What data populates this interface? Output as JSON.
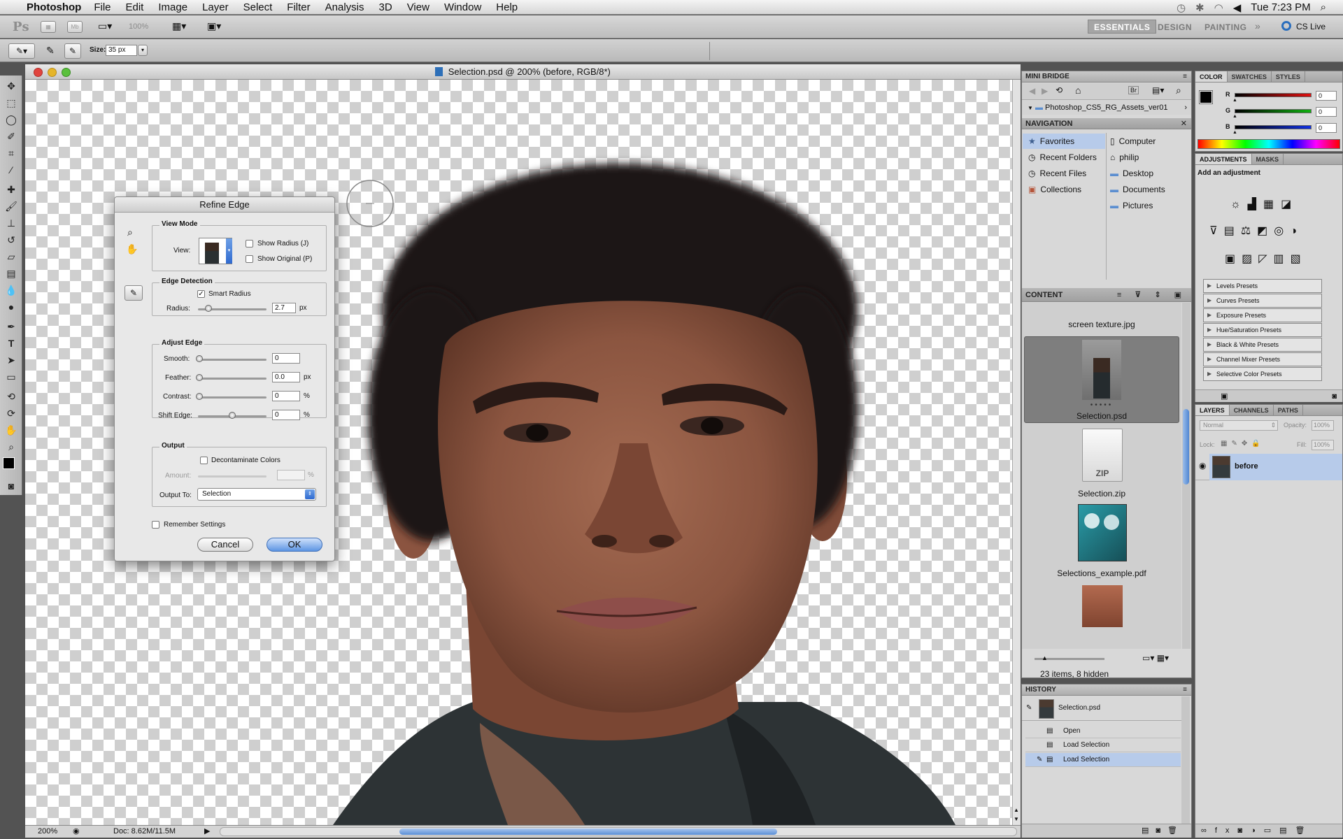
{
  "menubar": {
    "app_name": "Photoshop",
    "items": [
      "File",
      "Edit",
      "Image",
      "Layer",
      "Select",
      "Filter",
      "Analysis",
      "3D",
      "View",
      "Window",
      "Help"
    ],
    "clock": "Tue 7:23 PM"
  },
  "appbar": {
    "zoom": "100%",
    "workspaces": [
      "ESSENTIALS",
      "DESIGN",
      "PAINTING"
    ],
    "cs_live": "CS Live"
  },
  "options": {
    "size_label": "Size:",
    "size_value": "35 px"
  },
  "document": {
    "title": "Selection.psd @ 200% (before, RGB/8*)",
    "zoom": "200%",
    "doc_info": "Doc: 8.62M/11.5M"
  },
  "dialog": {
    "title": "Refine Edge",
    "view_mode": {
      "label": "View Mode",
      "view": "View:",
      "show_radius": "Show Radius (J)",
      "show_original": "Show Original (P)"
    },
    "edge_detection": {
      "label": "Edge Detection",
      "smart_radius": "Smart Radius",
      "radius_label": "Radius:",
      "radius_value": "2.7",
      "radius_unit": "px",
      "radius_frac": 0.15
    },
    "adjust_edge": {
      "label": "Adjust Edge",
      "smooth_label": "Smooth:",
      "smooth_value": "0",
      "feather_label": "Feather:",
      "feather_value": "0.0",
      "feather_unit": "px",
      "contrast_label": "Contrast:",
      "contrast_value": "0",
      "contrast_unit": "%",
      "shift_label": "Shift Edge:",
      "shift_value": "0",
      "shift_unit": "%",
      "shift_frac": 0.5
    },
    "output": {
      "label": "Output",
      "decontaminate": "Decontaminate Colors",
      "amount_label": "Amount:",
      "amount_unit": "%",
      "output_to_label": "Output To:",
      "output_to_value": "Selection"
    },
    "remember": "Remember Settings",
    "cancel": "Cancel",
    "ok": "OK"
  },
  "mini_bridge": {
    "title": "MINI BRIDGE",
    "path": "Photoshop_CS5_RG_Assets_ver01",
    "nav_header": "NAVIGATION",
    "left_items": [
      "Favorites",
      "Recent Folders",
      "Recent Files",
      "Collections"
    ],
    "right_items": [
      "Computer",
      "philip",
      "Desktop",
      "Documents",
      "Pictures"
    ],
    "content_header": "CONTENT",
    "files": [
      "screen texture.jpg",
      "Selection.psd",
      "Selection.zip",
      "Selections_example.pdf"
    ],
    "zip_label": "ZIP",
    "status": "23 items, 8 hidden"
  },
  "history": {
    "title": "HISTORY",
    "snapshot": "Selection.psd",
    "steps": [
      "Open",
      "Load Selection",
      "Load Selection"
    ]
  },
  "color_panel": {
    "tabs": [
      "COLOR",
      "SWATCHES",
      "STYLES"
    ],
    "channels": [
      {
        "name": "R",
        "value": "0",
        "color": "#e01010"
      },
      {
        "name": "G",
        "value": "0",
        "color": "#10b010"
      },
      {
        "name": "B",
        "value": "0",
        "color": "#1030e0"
      }
    ]
  },
  "adjustments": {
    "tabs": [
      "ADJUSTMENTS",
      "MASKS"
    ],
    "hint": "Add an adjustment",
    "presets": [
      "Levels Presets",
      "Curves Presets",
      "Exposure Presets",
      "Hue/Saturation Presets",
      "Black & White Presets",
      "Channel Mixer Presets",
      "Selective Color Presets"
    ]
  },
  "layers": {
    "tabs": [
      "LAYERS",
      "CHANNELS",
      "PATHS"
    ],
    "blend": "Normal",
    "opacity_label": "Opacity:",
    "opacity": "100%",
    "lock_label": "Lock:",
    "fill_label": "Fill:",
    "fill": "100%",
    "layer_name": "before"
  }
}
